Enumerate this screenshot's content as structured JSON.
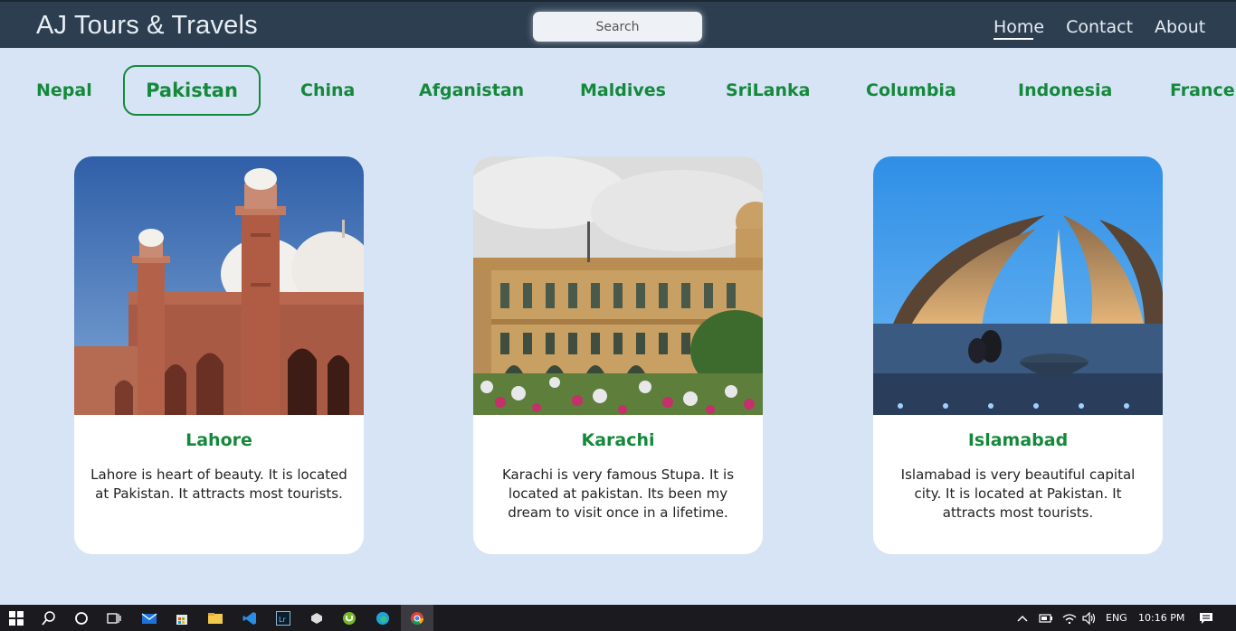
{
  "navbar": {
    "brand": "AJ Tours & Travels",
    "search_placeholder": "Search",
    "links": [
      {
        "label": "Home",
        "active": true
      },
      {
        "label": "Contact",
        "active": false
      },
      {
        "label": "About",
        "active": false
      }
    ]
  },
  "tabs": [
    "Nepal",
    "Pakistan",
    "China",
    "Afganistan",
    "Maldives",
    "SriLanka",
    "Columbia",
    "Indonesia",
    "France"
  ],
  "active_tab": "Pakistan",
  "cards": [
    {
      "title": "Lahore",
      "text": "Lahore is heart of beauty. It is located at Pakistan. It attracts most tourists.",
      "image": "badshahi-mosque-photo"
    },
    {
      "title": "Karachi",
      "text": "Karachi is very famous Stupa. It is located at pakistan. Its been my dream to visit once in a lifetime.",
      "image": "karachi-building-photo"
    },
    {
      "title": "Islamabad",
      "text": "Islamabad is very beautiful capital city. It is located at Pakistan. It attracts most tourists.",
      "image": "pakistan-monument-photo"
    }
  ],
  "taskbar": {
    "language": "ENG",
    "time": "10:16 PM"
  },
  "colors": {
    "navbar": "#2c3e50",
    "background": "#d6e4f5",
    "accent_green": "#15893b",
    "taskbar": "#1b1b1f"
  }
}
